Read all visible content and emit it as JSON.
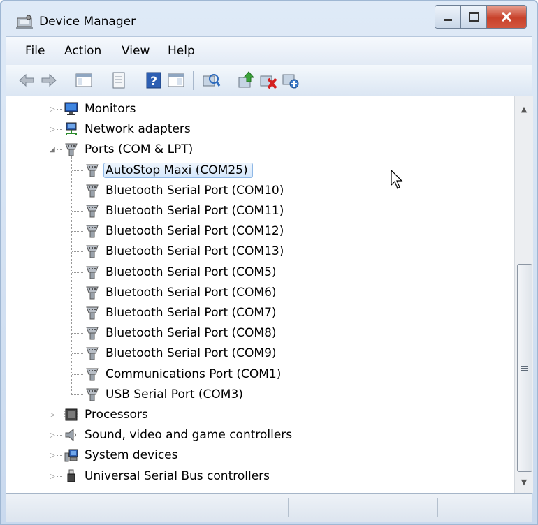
{
  "window": {
    "title": "Device Manager"
  },
  "menu": [
    "File",
    "Action",
    "View",
    "Help"
  ],
  "toolbar": [
    "back-icon",
    "forward-icon",
    "show-hide-console-tree-icon",
    "properties-icon",
    "help-icon",
    "show-action-pane-icon",
    "scan-hardware-changes-icon",
    "update-driver-icon",
    "uninstall-icon",
    "disable-icon"
  ],
  "tree": {
    "categories_top": [
      {
        "label": "Monitors",
        "icon": "monitor-icon"
      },
      {
        "label": "Network adapters",
        "icon": "network-adapter-icon"
      },
      {
        "label": "Ports (COM & LPT)",
        "icon": "port-icon"
      }
    ],
    "ports": [
      "AutoStop Maxi (COM25)",
      "Bluetooth Serial Port (COM10)",
      "Bluetooth Serial Port (COM11)",
      "Bluetooth Serial Port (COM12)",
      "Bluetooth Serial Port (COM13)",
      "Bluetooth Serial Port (COM5)",
      "Bluetooth Serial Port (COM6)",
      "Bluetooth Serial Port (COM7)",
      "Bluetooth Serial Port (COM8)",
      "Bluetooth Serial Port (COM9)",
      "Communications Port (COM1)",
      "USB Serial Port (COM3)"
    ],
    "categories_bottom": [
      {
        "label": "Processors",
        "icon": "processor-icon"
      },
      {
        "label": "Sound, video and game controllers",
        "icon": "speaker-icon"
      },
      {
        "label": "System devices",
        "icon": "system-devices-icon"
      },
      {
        "label": "Universal Serial Bus controllers",
        "icon": "usb-icon"
      }
    ]
  }
}
